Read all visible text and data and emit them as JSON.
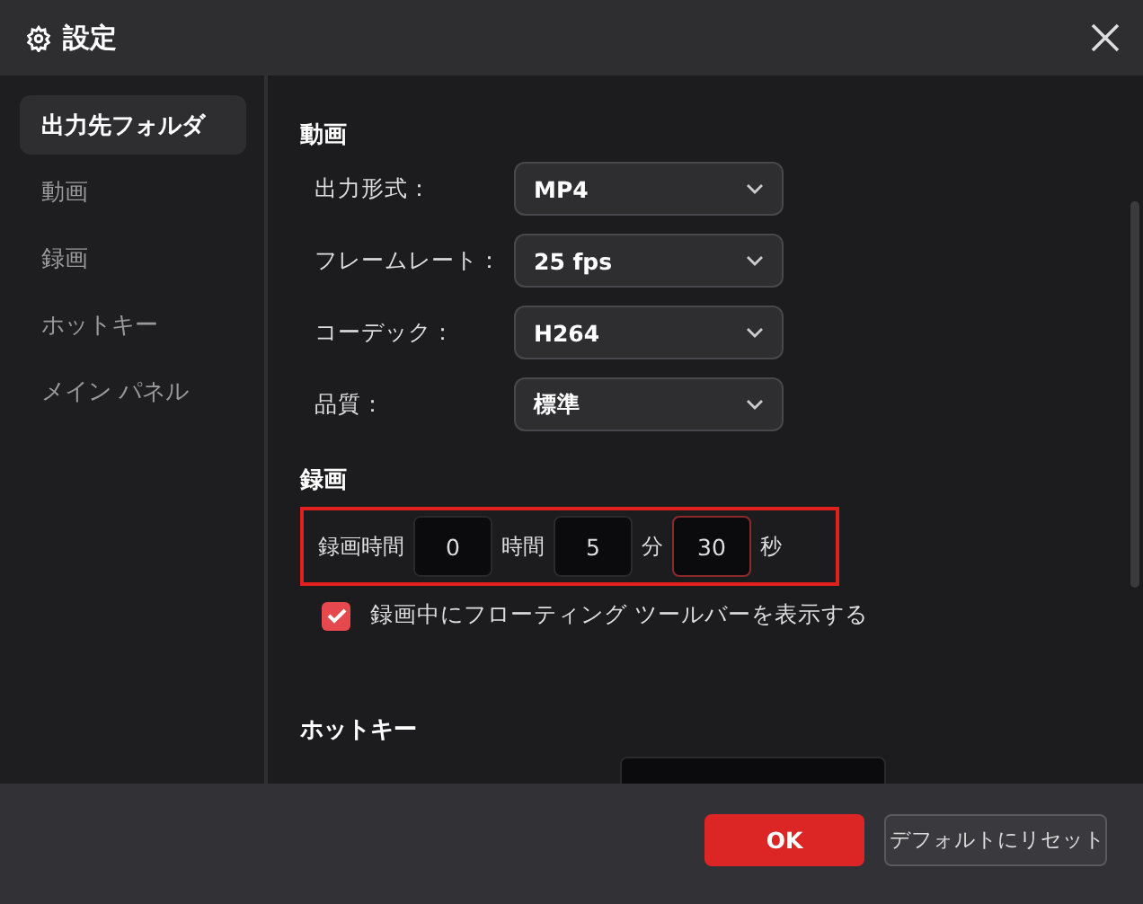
{
  "window": {
    "title": "設定"
  },
  "sidebar": {
    "items": [
      {
        "label": "出力先フォルダ",
        "selected": true
      },
      {
        "label": "動画",
        "selected": false
      },
      {
        "label": "録画",
        "selected": false
      },
      {
        "label": "ホットキー",
        "selected": false
      },
      {
        "label": "メイン パネル",
        "selected": false
      }
    ]
  },
  "video": {
    "heading": "動画",
    "settings": [
      {
        "label": "出力形式：",
        "value": "MP4"
      },
      {
        "label": "フレームレート：",
        "value": "25 fps"
      },
      {
        "label": "コーデック：",
        "value": "H264"
      },
      {
        "label": "品質：",
        "value": "標準"
      }
    ]
  },
  "recording": {
    "heading": "録画",
    "duration_label": "録画時間",
    "duration": [
      {
        "value": "0",
        "unit": "時間",
        "focused": false
      },
      {
        "value": "5",
        "unit": "分",
        "focused": false
      },
      {
        "value": "30",
        "unit": "秒",
        "focused": true
      }
    ],
    "floating_toolbar": {
      "label": "録画中にフローティング ツールバーを表示する",
      "checked": true
    }
  },
  "hotkeys": {
    "heading": "ホットキー"
  },
  "footer": {
    "buttons": [
      {
        "label": "OK",
        "kind": "primary"
      },
      {
        "label": "デフォルトにリセット",
        "kind": "secondary"
      }
    ]
  }
}
